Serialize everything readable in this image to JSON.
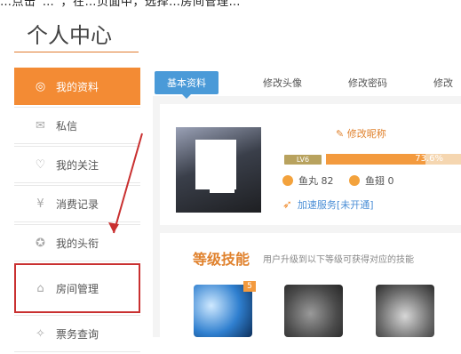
{
  "top_caption": "…点击“…”，在…页面中，选择…房间管理…",
  "page_title": "个人中心",
  "sidebar": {
    "items": [
      {
        "label": "我的资料",
        "icon": "user-circle-icon"
      },
      {
        "label": "私信",
        "icon": "envelope-icon"
      },
      {
        "label": "我的关注",
        "icon": "heart-icon"
      },
      {
        "label": "消费记录",
        "icon": "yen-icon"
      },
      {
        "label": "我的头衔",
        "icon": "badge-icon"
      },
      {
        "label": "房间管理",
        "icon": "house-icon"
      },
      {
        "label": "票务查询",
        "icon": "ticket-icon"
      }
    ]
  },
  "tabs": [
    "基本资料",
    "修改头像",
    "修改密码",
    "修改"
  ],
  "profile": {
    "edit_nick": "修改昵称",
    "level": "LV6",
    "level_progress": "73.6%",
    "level_fraction": 0.736,
    "coins": [
      {
        "label": "鱼丸 82"
      },
      {
        "label": "鱼翅 0"
      }
    ],
    "speed_service": "加速服务",
    "speed_status": "[未开通]"
  },
  "skills": {
    "title": "等级技能",
    "subtitle": "用户升级到以下等级可获得对应的技能",
    "badge": "5"
  },
  "colors": {
    "accent": "#f38b34",
    "tab_active": "#4a9ad8",
    "highlight_box": "#c93030"
  }
}
